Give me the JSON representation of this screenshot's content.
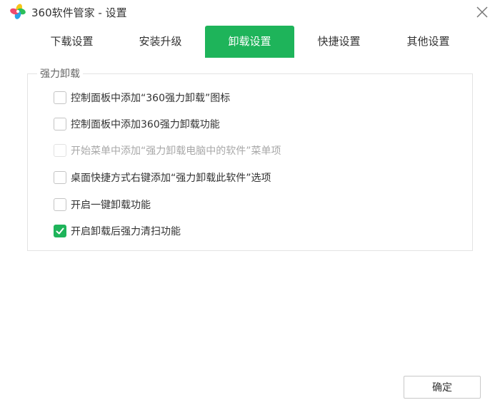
{
  "window": {
    "title": "360软件管家 - 设置",
    "logo_icon": "360-pinwheel-logo",
    "close_icon": "close-icon"
  },
  "tabs": [
    {
      "label": "下载设置",
      "active": false
    },
    {
      "label": "安装升级",
      "active": false
    },
    {
      "label": "卸载设置",
      "active": true
    },
    {
      "label": "快捷设置",
      "active": false
    },
    {
      "label": "其他设置",
      "active": false
    }
  ],
  "group": {
    "title": "强力卸载",
    "options": [
      {
        "label": "控制面板中添加“360强力卸载”图标",
        "checked": false,
        "disabled": false
      },
      {
        "label": "控制面板中添加360强力卸载功能",
        "checked": false,
        "disabled": false
      },
      {
        "label": "开始菜单中添加“强力卸载电脑中的软件”菜单项",
        "checked": false,
        "disabled": true
      },
      {
        "label": "桌面快捷方式右键添加“强力卸载此软件”选项",
        "checked": false,
        "disabled": false
      },
      {
        "label": "开启一键卸载功能",
        "checked": false,
        "disabled": false
      },
      {
        "label": "开启卸载后强力清扫功能",
        "checked": true,
        "disabled": false
      }
    ]
  },
  "footer": {
    "ok_label": "确定"
  },
  "colors": {
    "accent": "#1eb45a",
    "border": "#e3e3e3",
    "disabled_text": "#a8a8a8"
  }
}
